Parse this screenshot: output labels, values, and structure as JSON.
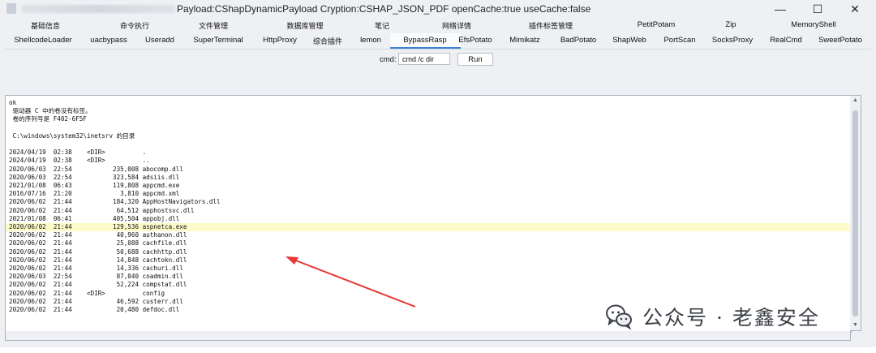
{
  "titlebar": {
    "title": "Payload:CShapDynamicPayload Cryption:CSHAP_JSON_PDF openCache:true useCache:false",
    "minimize": "—",
    "maximize": "☐",
    "close": "✕"
  },
  "tabs_row1": [
    "基础信息",
    "命令执行",
    "文件管理",
    "数据库管理",
    "笔记",
    "网络详情",
    "插件标签管理",
    "PetitPotam",
    "Zip",
    "MemoryShell"
  ],
  "tabs_row2": [
    "ShellcodeLoader",
    "uacbypass",
    "Useradd",
    "SuperTerminal",
    "HttpProxy",
    "综合插件",
    "lemon",
    "BypassRasp",
    "EfsPotato",
    "Mimikatz",
    "BadPotato",
    "ShapWeb",
    "PortScan",
    "SocksProxy",
    "RealCmd",
    "SweetPotato"
  ],
  "active_tab": "BypassRasp",
  "cmd": {
    "label": "cmd:",
    "value": "cmd /c dir",
    "run_label": "Run"
  },
  "output_lines": [
    "ok",
    " 驱动器 C 中的卷没有标签。",
    " 卷的序列号是 F402-6F5F",
    "",
    " C:\\windows\\system32\\inetsrv 的目录",
    "",
    "2024/04/19  02:38    <DIR>          .",
    "2024/04/19  02:38    <DIR>          ..",
    "2020/06/03  22:54           235,008 abocomp.dll",
    "2020/06/03  22:54           323,584 adsiis.dll",
    "2021/01/08  06:43           119,808 appcmd.exe",
    "2016/07/16  21:20             3,810 appcmd.xml",
    "2020/06/02  21:44           184,320 AppHostNavigators.dll",
    "2020/06/02  21:44            64,512 apphostsvc.dll",
    "2021/01/08  06:41           405,504 appobj.dll",
    "2020/06/02  21:44           129,536 aspnetca.exe",
    "2020/06/02  21:44            40,960 authanon.dll",
    "2020/06/02  21:44            25,088 cachfile.dll",
    "2020/06/02  21:44            50,688 cachhttp.dll",
    "2020/06/02  21:44            14,848 cachtokn.dll",
    "2020/06/02  21:44            14,336 cachuri.dll",
    "2020/06/03  22:54            87,040 coadmin.dll",
    "2020/06/02  21:44            52,224 compstat.dll",
    "2020/06/02  21:44    <DIR>          config",
    "2020/06/02  21:44            46,592 custerr.dll",
    "2020/06/02  21:44            20,480 defdoc.dll"
  ],
  "highlighted_line_index": 15,
  "watermark": {
    "text": "公众号 · 老鑫安全",
    "icon": "wechat-icon"
  },
  "colors": {
    "accent": "#3c82d6",
    "highlight": "#fdfbc9",
    "arrow": "#e53935"
  }
}
